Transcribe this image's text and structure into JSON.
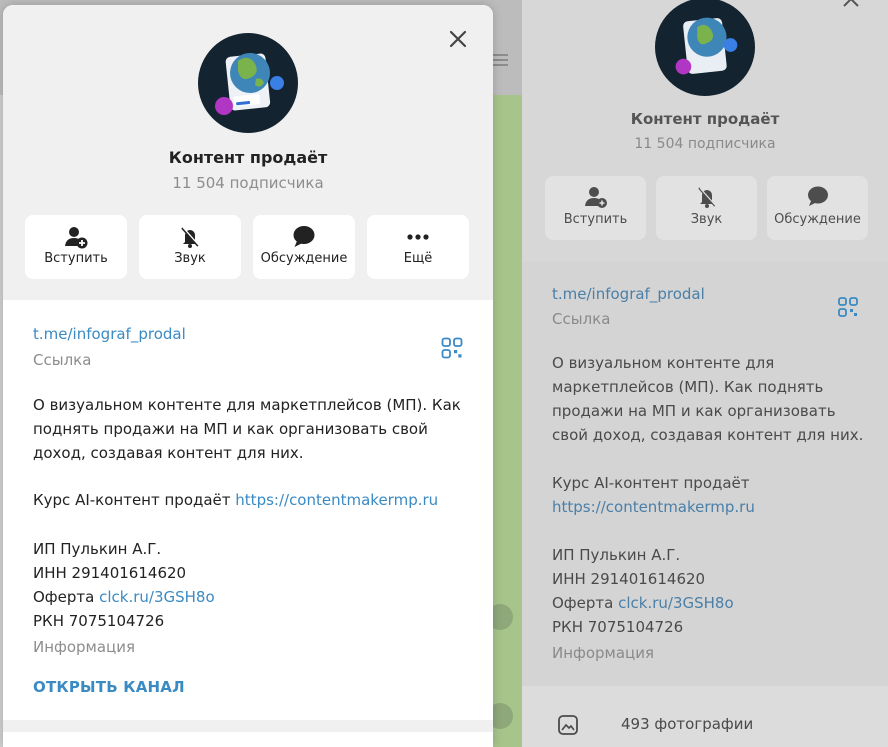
{
  "channel": {
    "title": "Контент продаёт",
    "subscribers": "11 504 подписчика"
  },
  "actions": [
    {
      "label": "Вступить",
      "icon": "add-user-icon"
    },
    {
      "label": "Звук",
      "icon": "bell-muted-icon"
    },
    {
      "label": "Обсуждение",
      "icon": "chat-bubble-icon"
    },
    {
      "label": "Ещё",
      "icon": "more-dots-icon"
    }
  ],
  "link": {
    "url": "t.me/infograf_prodal",
    "caption": "Ссылка"
  },
  "about": {
    "line1": "О визуальном контенте для маркетплейсов (МП). Как",
    "line2": "поднять продажи на МП и как организовать свой",
    "line3": "доход, создавая контент для них.",
    "course_prefix": "Курс AI-контент продаёт ",
    "course_link": "https://contentmakermp.ru",
    "ip": "ИП Пулькин А.Г.",
    "inn": "ИНН 291401614620",
    "oferta_prefix": "Оферта ",
    "oferta_link": "clck.ru/3GSH8o",
    "rkn": "РКН 7075104726",
    "caption": "Информация"
  },
  "open_channel": "ОТКРЫТЬ КАНАЛ",
  "right_panel": {
    "title": "Контент продаёт",
    "subscribers": "11 504 подписчика",
    "actions": [
      "Вступить",
      "Звук",
      "Обсуждение"
    ],
    "link_url": "t.me/infograf_prodal",
    "link_caption": "Ссылка",
    "about_lines": [
      "О визуальном контенте для",
      "маркетплейсов (МП). Как поднять",
      "продажи на МП и как организовать",
      "свой доход, создавая контент для них."
    ],
    "course_prefix": "Курс AI-контент продаёт",
    "course_link": "https://contentmakermp.ru",
    "ip": "ИП Пулькин А.Г.",
    "inn": "ИНН 291401614620",
    "oferta_prefix": "Оферта ",
    "oferta_link": "clck.ru/3GSH8o",
    "rkn": "РКН 7075104726",
    "info_caption": "Информация",
    "photos": "493 фотографии"
  },
  "colors": {
    "accent": "#3a8ac4",
    "header_bg": "#f0f0f0",
    "muted_text": "#8d8d8d"
  }
}
